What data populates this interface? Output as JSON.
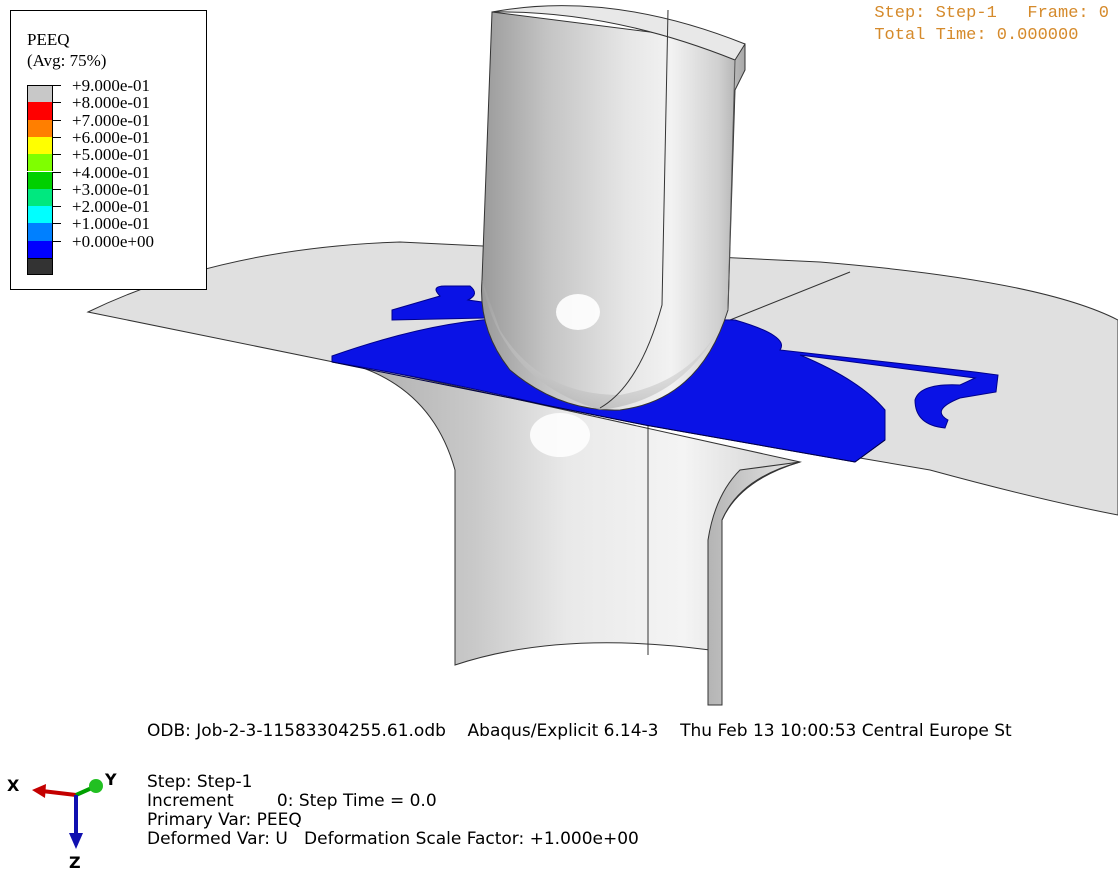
{
  "legend": {
    "title_line1": "PEEQ",
    "title_line2": "(Avg: 75%)",
    "entries": [
      {
        "label": "+9.000e-01",
        "color": "#c8c8c8"
      },
      {
        "label": "+8.000e-01",
        "color": "#ff0000"
      },
      {
        "label": "+7.000e-01",
        "color": "#ff7f00"
      },
      {
        "label": "+6.000e-01",
        "color": "#ffff00"
      },
      {
        "label": "+5.000e-01",
        "color": "#7fff00"
      },
      {
        "label": "+4.000e-01",
        "color": "#00d000"
      },
      {
        "label": "+3.000e-01",
        "color": "#00e87f"
      },
      {
        "label": "+2.000e-01",
        "color": "#00ffff"
      },
      {
        "label": "+1.000e-01",
        "color": "#0080ff"
      },
      {
        "label": "+0.000e+00",
        "color": "#0000ff"
      }
    ],
    "bottom_swatch_color": "#333333"
  },
  "step_info": {
    "line1": "Step: Step-1   Frame: 0",
    "line2": "Total Time: 0.000000"
  },
  "odb_line": "ODB: Job-2-3-11583304255.61.odb    Abaqus/Explicit 6.14-3    Thu Feb 13 10:00:53 Central Europe St",
  "info": {
    "step": "Step: Step-1",
    "increment": "Increment        0: Step Time = 0.0",
    "primary_var": "Primary Var: PEEQ",
    "deformed_var": "Deformed Var: U   Deformation Scale Factor: +1.000e+00"
  },
  "triad": {
    "x_label": "X",
    "y_label": "Y",
    "z_label": "Z"
  },
  "colors": {
    "part_blue": "#0a12e6",
    "part_gray": "#d8d8d8",
    "step_text": "#d58a2b"
  }
}
